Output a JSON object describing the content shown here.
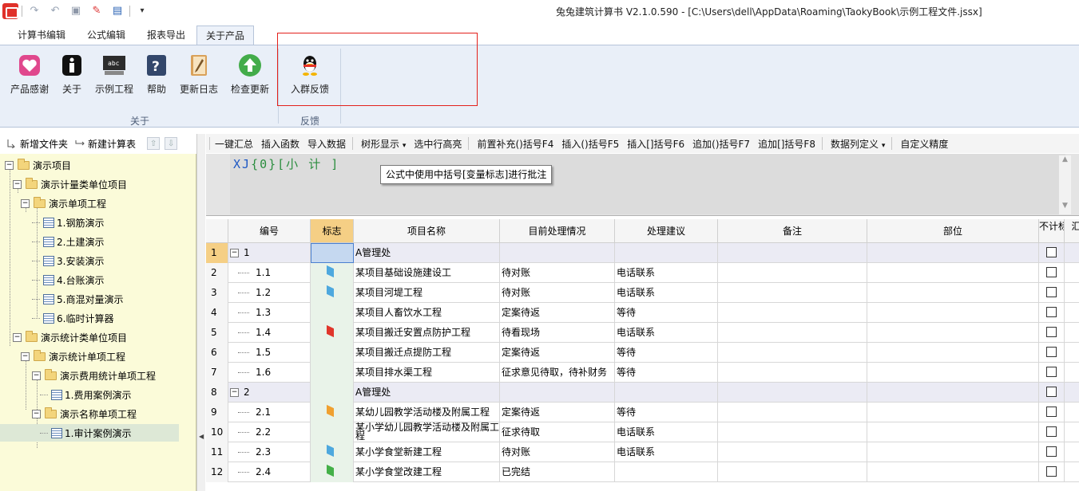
{
  "window": {
    "title": "兔兔建筑计算书 V2.1.0.590 - [C:\\Users\\dell\\AppData\\Roaming\\TaokyBook\\示例工程文件.jssx]"
  },
  "quick_access": [
    "redo-icon",
    "undo-icon",
    "save-icon",
    "pin-icon",
    "layout-icon",
    "dropdown-icon"
  ],
  "tabs": [
    "计算书编辑",
    "公式编辑",
    "报表导出",
    "关于产品"
  ],
  "active_tab": "关于产品",
  "ribbon": {
    "buttons": [
      {
        "label": "产品感谢",
        "icon": "heart-icon"
      },
      {
        "label": "关于",
        "icon": "info-icon"
      },
      {
        "label": "示例工程",
        "icon": "terminal-icon"
      },
      {
        "label": "帮助",
        "icon": "help-icon"
      },
      {
        "label": "更新日志",
        "icon": "notebook-icon"
      },
      {
        "label": "检查更新",
        "icon": "upload-arrow-icon"
      },
      {
        "label": "入群反馈",
        "icon": "qq-penguin-icon"
      }
    ],
    "groups": [
      "关于",
      "反馈"
    ]
  },
  "sidebar": {
    "toolbar": [
      "新增文件夹",
      "新建计算表"
    ],
    "tree": [
      {
        "label": "演示项目",
        "type": "folder",
        "level": 0
      },
      {
        "label": "演示计量类单位项目",
        "type": "folder",
        "level": 1
      },
      {
        "label": "演示单项工程",
        "type": "folder",
        "level": 2
      },
      {
        "label": "1.钢筋演示",
        "type": "doc",
        "level": 3
      },
      {
        "label": "2.土建演示",
        "type": "doc",
        "level": 3
      },
      {
        "label": "3.安装演示",
        "type": "doc",
        "level": 3
      },
      {
        "label": "4.台账演示",
        "type": "doc",
        "level": 3
      },
      {
        "label": "5.商混对量演示",
        "type": "doc",
        "level": 3
      },
      {
        "label": "6.临时计算器",
        "type": "doc",
        "level": 3
      },
      {
        "label": "演示统计类单位项目",
        "type": "folder",
        "level": 1
      },
      {
        "label": "演示统计单项工程",
        "type": "folder",
        "level": 2
      },
      {
        "label": "演示费用统计单项工程",
        "type": "folder",
        "level": 3
      },
      {
        "label": "1.费用案例演示",
        "type": "doc",
        "level": 4
      },
      {
        "label": "演示名称单项工程",
        "type": "folder",
        "level": 3
      },
      {
        "label": "1.审计案例演示",
        "type": "doc",
        "level": 4,
        "selected": true
      }
    ]
  },
  "main_toolbar": [
    "一键汇总",
    "插入函数",
    "导入数据",
    "树形显示",
    "选中行高亮",
    "前置补充()括号F4",
    "插入()括号F5",
    "插入[]括号F6",
    "追加()括号F7",
    "追加[]括号F8",
    "数据列定义",
    "自定义精度"
  ],
  "formula": {
    "prefix": "XJ",
    "brace": "{0}",
    "bracket": "[小 计 ]",
    "tooltip": "公式中使用中括号[变量标志]进行批注"
  },
  "grid": {
    "columns": [
      "编号",
      "标志",
      "项目名称",
      "目前处理情况",
      "处理建议",
      "备注",
      "部位",
      "不计标志",
      "汇"
    ],
    "rows": [
      {
        "row": "1",
        "code": "1",
        "group": true,
        "name": "A管理处",
        "status": "",
        "advice": "",
        "flag": ""
      },
      {
        "row": "2",
        "code": "1.1",
        "name": "某项目基础设施建设工",
        "status": "待对账",
        "advice": "电话联系",
        "flag": "#4ea8de"
      },
      {
        "row": "3",
        "code": "1.2",
        "name": "某项目河堤工程",
        "status": "待对账",
        "advice": "电话联系",
        "flag": "#4ea8de"
      },
      {
        "row": "4",
        "code": "1.3",
        "name": "某项目人畜饮水工程",
        "status": "定案待返",
        "advice": "等待",
        "flag": ""
      },
      {
        "row": "5",
        "code": "1.4",
        "name": "某项目搬迁安置点防护工程",
        "status": "待看现场",
        "advice": "电话联系",
        "flag": "#e0352b"
      },
      {
        "row": "6",
        "code": "1.5",
        "name": "某项目搬迁点提防工程",
        "status": "定案待返",
        "advice": "等待",
        "flag": ""
      },
      {
        "row": "7",
        "code": "1.6",
        "name": "某项目排水渠工程",
        "status": "征求意见待取，待补财务",
        "advice": "等待",
        "flag": ""
      },
      {
        "row": "8",
        "code": "2",
        "group": true,
        "name": "A管理处",
        "status": "",
        "advice": "",
        "flag": ""
      },
      {
        "row": "9",
        "code": "2.1",
        "name": "某幼儿园教学活动楼及附属工程",
        "status": "定案待返",
        "advice": "等待",
        "flag": "#f0a030"
      },
      {
        "row": "10",
        "code": "2.2",
        "name": "某小学幼儿园教学活动楼及附属工程",
        "status": "征求待取",
        "advice": "电话联系",
        "flag": ""
      },
      {
        "row": "11",
        "code": "2.3",
        "name": "某小学食堂新建工程",
        "status": "待对账",
        "advice": "电话联系",
        "flag": "#4ea8de"
      },
      {
        "row": "12",
        "code": "2.4",
        "name": "某小学食堂改建工程",
        "status": "已完结",
        "advice": "",
        "flag": "#44b048"
      }
    ]
  }
}
